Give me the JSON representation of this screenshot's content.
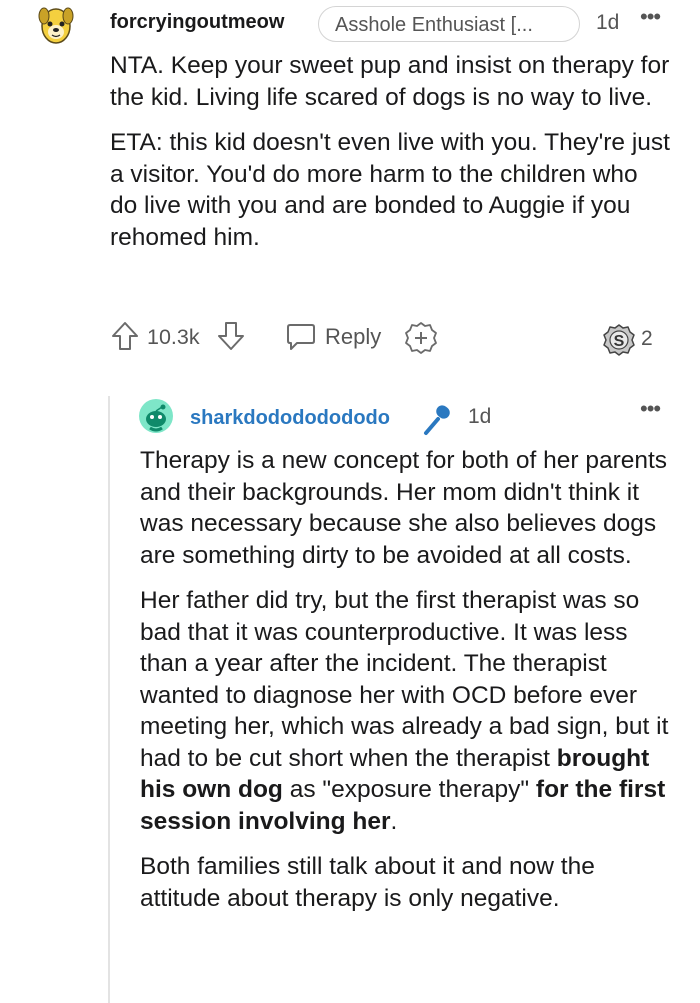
{
  "comment": {
    "username": "forcryingoutmeow",
    "flair": "Asshole Enthusiast [...",
    "time": "1d",
    "more": "•••",
    "avatar_icon": "dog-avatar-icon",
    "paragraphs": [
      "NTA. Keep your sweet pup and insist on therapy for the kid. Living life scared of dogs is no way to live.",
      "ETA: this kid doesn't even live with you. They're just a visitor. You'd do more harm to the children who do live with you and are bonded to Auggie if you rehomed him."
    ],
    "actions": {
      "score": "10.3k",
      "reply": "Reply",
      "award_count": "2"
    }
  },
  "reply": {
    "username": "sharkdodododododo",
    "time": "1d",
    "more": "•••",
    "avatar_icon": "snoo-avatar-icon",
    "badge_icon": "microphone-icon",
    "p1": "Therapy is a new concept for both of her parents and their backgrounds. Her mom didn't think it was necessary because she also believes dogs are something dirty to be avoided at all costs.",
    "p2": {
      "a": "Her father did try, but the first therapist was so bad that it was counterproductive. It was less than a year after the incident. The therapist wanted to diagnose her with OCD before ever meeting her, which was already a bad sign, but it had to be cut short when the therapist ",
      "b": "brought his own dog",
      "c": " as \"exposure therapy\" ",
      "d": "for the first session involving her",
      "e": "."
    },
    "p3": "Both families still talk about it and now the attitude about therapy is only negative."
  },
  "colors": {
    "username_link": "#2a78c0",
    "text": "#1a1a1b",
    "muted": "#555555"
  }
}
